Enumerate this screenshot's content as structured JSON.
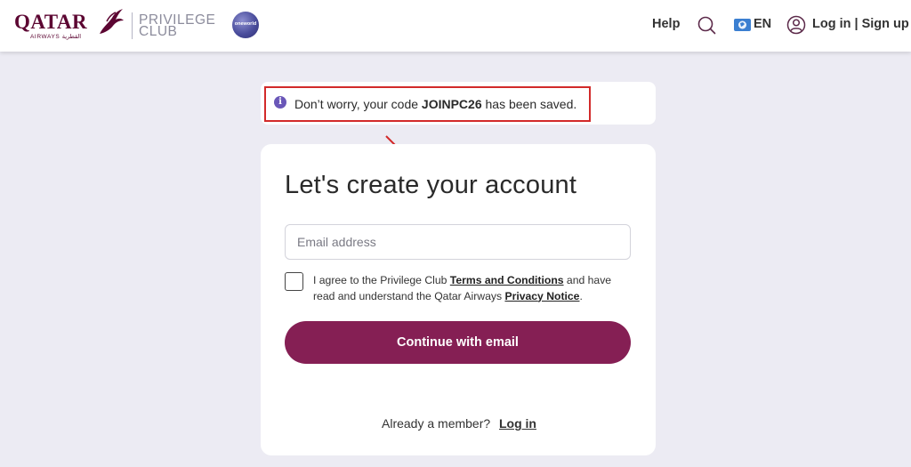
{
  "header": {
    "brand_name": "QATAR",
    "brand_sub": "AIRWAYS القطرية",
    "program_line1": "PRIVILEGE",
    "program_line2": "CLUB",
    "alliance_badge": "oneworld",
    "help_label": "Help",
    "language_label": "EN",
    "login_label": "Log in | Sign up",
    "icons": [
      "oryx-logo-icon",
      "search-icon",
      "globe-flag-icon",
      "user-icon"
    ]
  },
  "notice": {
    "prefix": "Don’t worry, your code ",
    "code": "JOINPC26",
    "suffix": " has been saved.",
    "highlight_color": "#d22a2a"
  },
  "form": {
    "title": "Let's create your account",
    "email_placeholder": "Email address",
    "email_value": "",
    "agree_part1": "I agree to the Privilege Club ",
    "terms_link": "Terms and Conditions",
    "agree_part2": " and have read and understand the Qatar Airways ",
    "privacy_link": "Privacy Notice",
    "agree_part3": ".",
    "checkbox_checked": false,
    "continue_label": "Continue with email",
    "member_prompt": "Already a member?",
    "member_login": "Log in"
  },
  "colors": {
    "brand": "#5c0632",
    "button": "#851f54",
    "background": "#ecebf3",
    "info": "#6a57b8",
    "annotation": "#d22a2a"
  }
}
